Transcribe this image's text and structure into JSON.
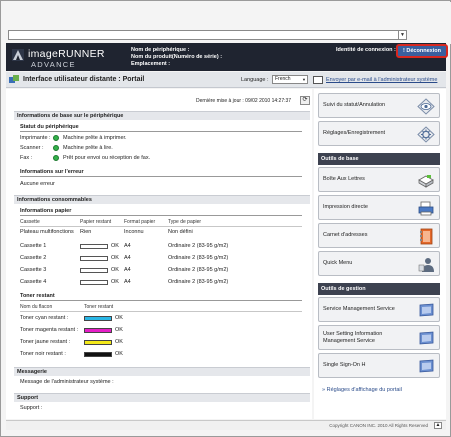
{
  "browser": {
    "address_arrow": "▼"
  },
  "header": {
    "logo_line1": "imageRUNNER",
    "logo_line2": "ADVANCE",
    "device_name_label": "Nom de périphérique :",
    "product_name_label": "Nom du produit(Numéro de série) :",
    "location_label": "Emplacement :",
    "identity_label": "Identité de connexion :",
    "logout_label": "Déconnexion"
  },
  "titlebar": {
    "title": "Interface utilisateur distante : Portail",
    "language_label": "Language :",
    "language_value": "French",
    "mail_link": "Envoyer par e-mail à l'administrateur système"
  },
  "main": {
    "last_updated": "Dernière mise à jour : 09/02 2010 14:27:37",
    "refresh_icon": "⟳",
    "basic_info_header": "Informations de base sur le périphérique",
    "device_status_header": "Statut du périphérique",
    "device_status": [
      {
        "device": "Imprimante :",
        "status": "Machine prête à imprimer."
      },
      {
        "device": "Scanner :",
        "status": "Machine prête à lire."
      },
      {
        "device": "Fax :",
        "status": "Prêt pour envoi ou réception de fax."
      }
    ],
    "error_header": "Informations sur l'erreur",
    "error_text": "Aucune erreur",
    "consumables_header": "Informations consommables",
    "paper_header": "Informations papier",
    "paper_columns": [
      "Cassette",
      "Papier restant",
      "Format papier",
      "Type de papier"
    ],
    "paper_rows": [
      {
        "source": "Plateau multifonctions",
        "remaining": "Rien",
        "ok": "",
        "size": "Inconnu",
        "type": "Non défini",
        "level": 0
      },
      {
        "source": "Cassette 1",
        "remaining": "",
        "ok": "OK",
        "size": "A4",
        "type": "Ordinaire 2 (83-95 g/m2)",
        "level": 0
      },
      {
        "source": "Cassette 2",
        "remaining": "",
        "ok": "OK",
        "size": "A4",
        "type": "Ordinaire 2 (83-95 g/m2)",
        "level": 0
      },
      {
        "source": "Cassette 3",
        "remaining": "",
        "ok": "OK",
        "size": "A4",
        "type": "Ordinaire 2 (83-95 g/m2)",
        "level": 0
      },
      {
        "source": "Cassette 4",
        "remaining": "",
        "ok": "OK",
        "size": "A4",
        "type": "Ordinaire 2 (83-95 g/m2)",
        "level": 0
      }
    ],
    "toner_header": "Toner restant",
    "toner_columns": [
      "Nom du flacon",
      "Toner restant"
    ],
    "toner_rows": [
      {
        "name": "Toner cyan restant :",
        "status": "OK",
        "color": "#2ab7e6",
        "level": 1.0
      },
      {
        "name": "Toner magenta restant :",
        "status": "OK",
        "color": "#e61ec8",
        "level": 1.0
      },
      {
        "name": "Toner jaune restant :",
        "status": "OK",
        "color": "#f4e91a",
        "level": 1.0
      },
      {
        "name": "Toner noir restant :",
        "status": "OK",
        "color": "#111111",
        "level": 1.0
      }
    ],
    "messaging_header": "Messagerie",
    "messaging_text": "Message de l'administrateur système :",
    "support_header": "Support",
    "support_text": "Support :"
  },
  "right_panel": {
    "status_monitor": "Suivi du statut/Annulation",
    "settings": "Réglages/Enregistrement",
    "basic_tools_header": "Outils de base",
    "mail_box": "Boîte Aux Lettres",
    "direct_print": "Impression directe",
    "address_book": "Carnet d'adresses",
    "quick_menu": "Quick Menu",
    "management_tools_header": "Outils de gestion",
    "service_mgmt": "Service Management Service",
    "user_setting_line1": "User Setting Information",
    "user_setting_line2": "Management Service",
    "sso": "Single Sign-On H",
    "portal_settings_link": "Réglages d'affichage du portail"
  },
  "footer": {
    "copyright": "Copyright CANON INC. 2010 All Rights Reserved",
    "to_top_icon": "▲"
  },
  "colors": {
    "header_bg": "#1f2430",
    "logout_border": "#d8271f",
    "status_green": "#33b04a",
    "link_blue": "#2a4b8a"
  }
}
